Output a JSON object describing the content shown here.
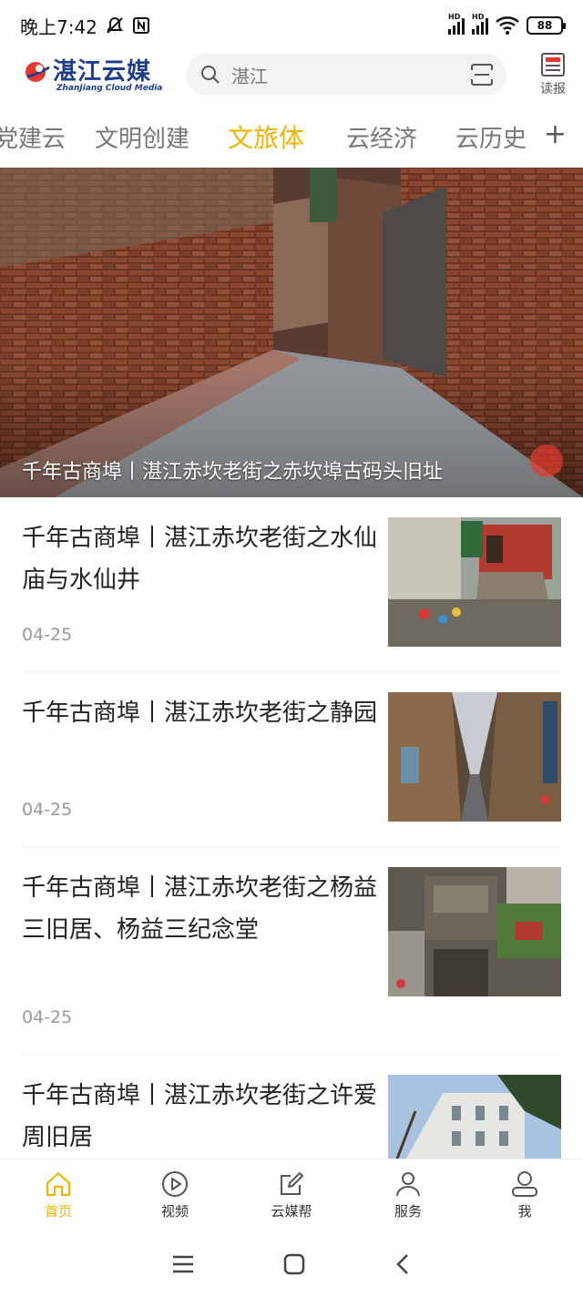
{
  "status": {
    "time": "晚上7:42",
    "battery": "88",
    "hd1": "HD",
    "hd2": "HD"
  },
  "header": {
    "logo_text": "湛江云媒",
    "logo_subtitle": "ZhanJiang Cloud Media",
    "search_value": "湛江",
    "reader_label": "读报"
  },
  "tabs": [
    {
      "label": "党建云"
    },
    {
      "label": "文明创建"
    },
    {
      "label": "文旅体",
      "active": true
    },
    {
      "label": "云经济"
    },
    {
      "label": "云历史"
    }
  ],
  "hero": {
    "title": "千年古商埠丨湛江赤坎老街之赤坎埠古码头旧址"
  },
  "articles": [
    {
      "title": "千年古商埠丨湛江赤坎老街之水仙庙与水仙井",
      "date": "04-25"
    },
    {
      "title": "千年古商埠丨湛江赤坎老街之静园",
      "date": "04-25"
    },
    {
      "title": "千年古商埠丨湛江赤坎老街之杨益三旧居、杨益三纪念堂",
      "date": "04-25"
    },
    {
      "title": "千年古商埠丨湛江赤坎老街之许爱周旧居",
      "date": ""
    }
  ],
  "bottom_nav": [
    {
      "label": "首页",
      "icon": "home-icon",
      "active": true
    },
    {
      "label": "视频",
      "icon": "play-icon"
    },
    {
      "label": "云媒帮",
      "icon": "edit-icon"
    },
    {
      "label": "服务",
      "icon": "person-icon"
    },
    {
      "label": "我",
      "icon": "profile-icon"
    }
  ],
  "colors": {
    "accent": "#f2b200",
    "brand": "#1d3e8e",
    "logo_red": "#e23a2e"
  }
}
